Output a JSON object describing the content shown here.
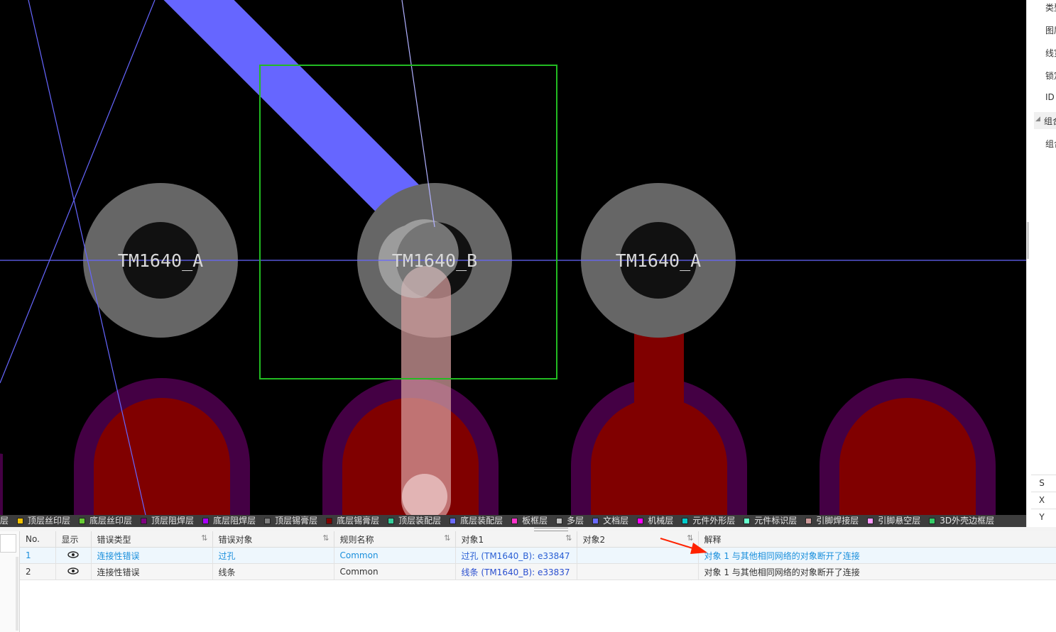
{
  "canvas": {
    "pad_labels": [
      "TM1640_A",
      "TM1640_B",
      "TM1640_A"
    ]
  },
  "right_panel": {
    "items": [
      "类型",
      "图层",
      "线宽",
      "锁定",
      "ID"
    ],
    "group_header": "组合",
    "group_item": "组合",
    "coords": [
      "S",
      "X",
      "Y"
    ]
  },
  "layers": [
    {
      "label": "层",
      "color": "#cccccc"
    },
    {
      "label": "顶层丝印层",
      "color": "#f2c200"
    },
    {
      "label": "底层丝印层",
      "color": "#66cc33"
    },
    {
      "label": "顶层阻焊层",
      "color": "#800080"
    },
    {
      "label": "底层阻焊层",
      "color": "#aa00ff"
    },
    {
      "label": "顶层锡膏层",
      "color": "#808080"
    },
    {
      "label": "底层锡膏层",
      "color": "#800000"
    },
    {
      "label": "顶层装配层",
      "color": "#33cc99"
    },
    {
      "label": "底层装配层",
      "color": "#6a6aff"
    },
    {
      "label": "板框层",
      "color": "#ff33cc"
    },
    {
      "label": "多层",
      "color": "#c0c0c0"
    },
    {
      "label": "文档层",
      "color": "#6a6aff"
    },
    {
      "label": "机械层",
      "color": "#ff00ff"
    },
    {
      "label": "元件外形层",
      "color": "#00cccc"
    },
    {
      "label": "元件标识层",
      "color": "#66ffcc"
    },
    {
      "label": "引脚焊接层",
      "color": "#cc9999"
    },
    {
      "label": "引脚悬空层",
      "color": "#ff99ff"
    },
    {
      "label": "3D外壳边框层",
      "color": "#33cc66"
    }
  ],
  "table": {
    "headers": [
      "No.",
      "显示",
      "错误类型",
      "错误对象",
      "规则名称",
      "对象1",
      "对象2",
      "解释"
    ],
    "sort_icon": "⇅",
    "rows": [
      {
        "no": "1",
        "type": "连接性错误",
        "object": "过孔",
        "rule": "Common",
        "obj1": "过孔 (TM1640_B): e33847",
        "obj2": "",
        "explain": "对象 1 与其他相同网络的对象断开了连接"
      },
      {
        "no": "2",
        "type": "连接性错误",
        "object": "线条",
        "rule": "Common",
        "obj1": "线条 (TM1640_B): e33837",
        "obj2": "",
        "explain": "对象 1 与其他相同网络的对象断开了连接"
      }
    ]
  },
  "colors": {
    "canvas_bg": "#000000",
    "track_blue": "#6666ff",
    "pad_gray": "#666666",
    "pad_hole": "#111111",
    "bottom_pad": "#800000",
    "solder_mask": "#440044",
    "selection_box": "#22bb22",
    "highlight_track": "#d8a0a0",
    "annotation_arrow": "#ff2200"
  }
}
